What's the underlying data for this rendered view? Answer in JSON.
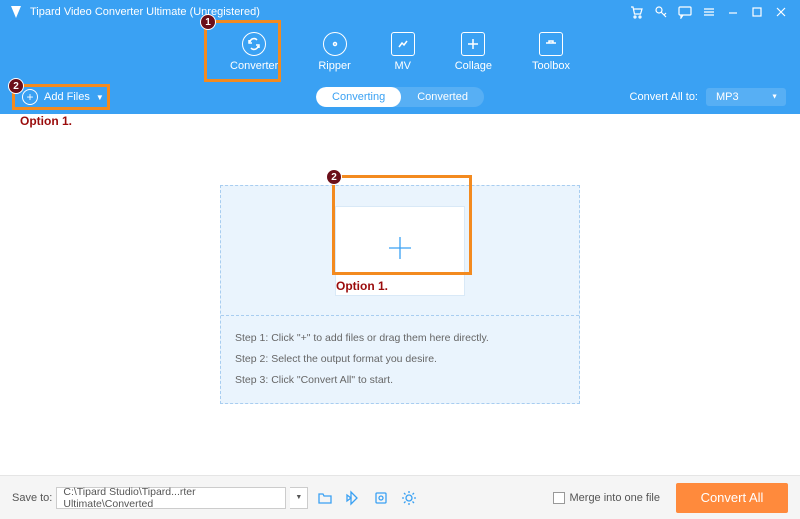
{
  "titlebar": {
    "title": "Tipard Video Converter Ultimate (Unregistered)"
  },
  "nav": {
    "converter": "Converter",
    "ripper": "Ripper",
    "mv": "MV",
    "collage": "Collage",
    "toolbox": "Toolbox"
  },
  "toolbar": {
    "add_files": "Add Files",
    "seg_converting": "Converting",
    "seg_converted": "Converted",
    "convert_all_to": "Convert All to:",
    "format_selected": "MP3"
  },
  "dropzone": {
    "step1": "Step 1: Click \"+\" to add files or drag them here directly.",
    "step2": "Step 2: Select the output format you desire.",
    "step3": "Step 3: Click \"Convert All\" to start."
  },
  "footer": {
    "save_to": "Save to:",
    "path": "C:\\Tipard Studio\\Tipard...rter Ultimate\\Converted",
    "merge": "Merge into one file",
    "convert_all": "Convert All"
  },
  "annotations": {
    "badge1": "1",
    "badge2": "2",
    "option1": "Option 1."
  }
}
